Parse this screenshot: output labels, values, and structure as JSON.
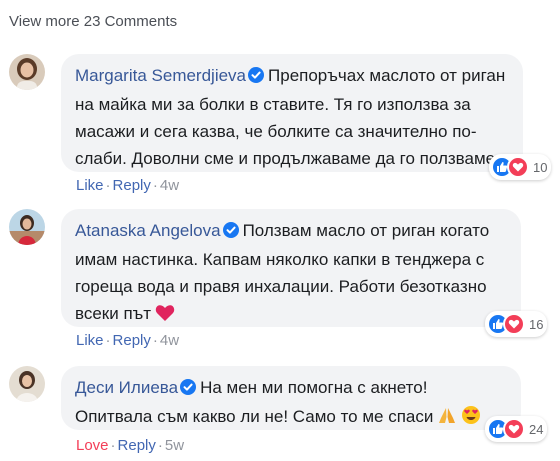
{
  "view_more": "View more 23 Comments",
  "comments": [
    {
      "author": "Margarita Semerdjieva",
      "text": "Препоръчах маслото от риган на майка ми за болки в ставите. Тя го използва за масажи и сега казва, че болките са значително по-слаби. Доволни сме и продължаваме да го ползваме редовно.",
      "action_primary": "Like",
      "reply": "Reply",
      "time": "4w",
      "reaction_count": "10"
    },
    {
      "author": "Atanaska Angelova",
      "text": "Ползвам масло от риган когато имам настинка. Капвам няколко капки в тенджера с гореща вода и правя инхалации. Работи безотказно всеки път",
      "action_primary": "Like",
      "reply": "Reply",
      "time": "4w",
      "reaction_count": "16"
    },
    {
      "author": "Деси Илиева",
      "text": "На мен ми помогна с акнето! Опитвала съм какво ли не! Само то ме спаси",
      "action_primary": "Love",
      "reply": "Reply",
      "time": "5w",
      "reaction_count": "24"
    }
  ],
  "colors": {
    "link": "#385898",
    "action": "#4267b2",
    "love": "#f33e58",
    "like": "#1877f2",
    "bubble": "#f2f3f5"
  }
}
